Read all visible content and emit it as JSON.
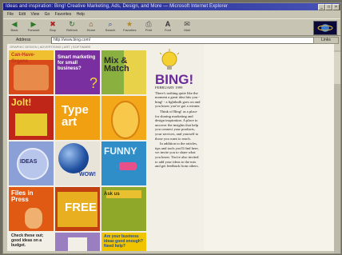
{
  "window": {
    "title": "Ideas and inspiration: Bing! Creative Marketing, Ads, Design, and More — Microsoft Internet Explorer",
    "menu": [
      "File",
      "Edit",
      "View",
      "Go",
      "Favorites",
      "Help"
    ],
    "toolbar_buttons": [
      {
        "label": "Back",
        "icon": "back-arrow-icon"
      },
      {
        "label": "Forward",
        "icon": "forward-arrow-icon"
      },
      {
        "label": "Stop",
        "icon": "stop-icon"
      },
      {
        "label": "Refresh",
        "icon": "refresh-icon"
      },
      {
        "label": "Home",
        "icon": "home-icon"
      },
      {
        "label": "Search",
        "icon": "search-icon"
      },
      {
        "label": "Favorites",
        "icon": "favorites-icon"
      },
      {
        "label": "Print",
        "icon": "print-icon"
      },
      {
        "label": "Font",
        "icon": "font-icon"
      },
      {
        "label": "Mail",
        "icon": "mail-icon"
      }
    ],
    "address_label": "Address",
    "address_value": "http://www.bing.com/",
    "links_label": "Links"
  },
  "page": {
    "breadcrumb": "GRAPHIC DESIGN | ADVERTISING | ART | SOFTWARE",
    "thumbs": [
      {
        "text": "Can-Have-Organs",
        "bg": "#d84a1a"
      },
      {
        "text": "Smart marketing for small business?",
        "bg": "#7a2fa0"
      },
      {
        "text": "Mix & Match",
        "bg": "#e7d24a"
      },
      {
        "text": "Jolt!",
        "bg": "#c02618"
      },
      {
        "text": "Type art",
        "bg": "#f0a010"
      },
      {
        "text": "",
        "bg": "#f2a818"
      },
      {
        "text": "IDEAS",
        "bg": "#8aa0d6"
      },
      {
        "text": "WOW!",
        "bg": "#e8e4da"
      },
      {
        "text": "FUNNY",
        "bg": "#2f8ec8"
      },
      {
        "text": "Files in Press",
        "bg": "#e05a14"
      },
      {
        "text": "FREE",
        "bg": "#c04010"
      },
      {
        "text": "Ask us",
        "bg": "#8fa82a"
      },
      {
        "text": "Check these out; good ideas on a budget.",
        "bg": "#f2efe6"
      },
      {
        "text": "",
        "bg": "#9a7fc0"
      },
      {
        "text": "Are your business ideas good enough? Need help?",
        "bg": "#f1c400"
      }
    ],
    "logo_text": "BING!",
    "article": [
      "FEBRUARY 1999",
      "There's nothing quite like the moment a great idea hits you - bing! - a lightbulb goes on and you know you've got a winner.",
      "Think of Bing! as a place for sharing marketing and design inspiration. A place to uncover the insights that help you connect your products, your services, and yourself to those you want to reach.",
      "In addition to the articles, tips and tools you'll find here, we invite you to share what you know. You're also invited to add your ideas to the mix and get feedback from others."
    ]
  }
}
